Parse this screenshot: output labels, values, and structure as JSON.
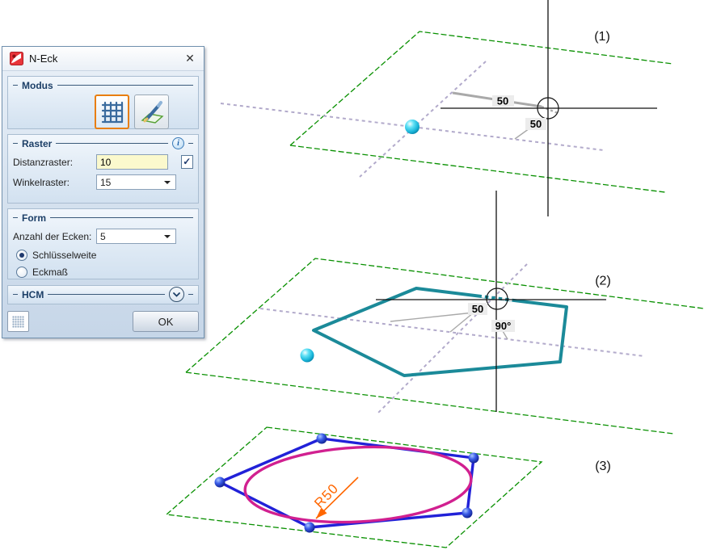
{
  "window": {
    "title": "N-Eck",
    "close_icon": "✕"
  },
  "dialog": {
    "groups": {
      "modus": {
        "label": "Modus"
      },
      "raster": {
        "label": "Raster",
        "info_icon": "i",
        "rows": [
          {
            "label": "Distanzraster:",
            "value": "10",
            "checkbox_checked": true
          },
          {
            "label": "Winkelraster:",
            "value": "15"
          }
        ]
      },
      "form": {
        "label": "Form",
        "corners_label": "Anzahl der Ecken:",
        "corners_value": "5",
        "radio_options": [
          {
            "label": "Schlüsselweite",
            "selected": true
          },
          {
            "label": "Eckmaß",
            "selected": false
          }
        ]
      },
      "hcm": {
        "label": "HCM"
      }
    },
    "ok_label": "OK",
    "check_glyph": "✓"
  },
  "viewport": {
    "figures": [
      {
        "label": "(1)",
        "dim_horizontal": "50",
        "dim_vertical": "50"
      },
      {
        "label": "(2)",
        "dim_distance": "50",
        "dim_angle": "90°"
      },
      {
        "label": "(3)",
        "dim_radius": "R50"
      }
    ]
  },
  "colors": {
    "plane_green": "#089000",
    "grid_line_lavender": "#b2aacb",
    "dimension_gray": "#a9a9a9",
    "polygon_teal": "#1b8a99",
    "polygon_blue": "#2121d8",
    "circle_magenta": "#d12090",
    "dimension_orange": "#ff6600",
    "sphere_cyan": "#18b4d8",
    "mode_button_active_border": "#e87e0e",
    "input_yellow": "#fbf9cd",
    "group_header_navy": "#1c3f67"
  }
}
